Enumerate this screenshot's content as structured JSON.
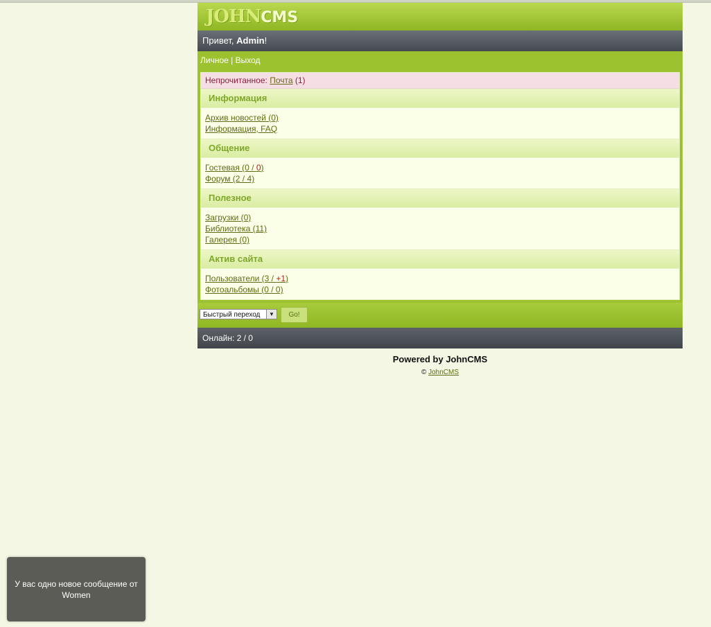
{
  "header": {
    "logo_main": "JOHN",
    "logo_sub": "CMS",
    "greeting_prefix": "Привет, ",
    "greeting_user": "Admin",
    "greeting_suffix": "!"
  },
  "nav": {
    "personal": "Личное",
    "separator": " | ",
    "logout": "Выход"
  },
  "unread": {
    "label": "Непрочитанное: ",
    "mail_link": "Почта",
    "mail_count": " (1)"
  },
  "sections": [
    {
      "title": "Информация",
      "links": [
        "Архив новостей (0)",
        "Информация, FAQ"
      ]
    },
    {
      "title": "Общение",
      "links": [
        "Гостевая (0 / ",
        "Форум (2 / 4)"
      ],
      "guest_red": "0",
      "guest_close": ")"
    },
    {
      "title": "Полезное",
      "links": [
        "Загрузки (0)",
        "Библиотека (11)",
        "Галерея (0)"
      ]
    },
    {
      "title": "Актив сайта",
      "links": [
        "Пользователи (3 / ",
        "Фотоальбомы (0 / 0)"
      ],
      "users_red": "+1",
      "users_close": ")"
    }
  ],
  "quick_jump": {
    "selected": "Быстрый переход",
    "go_label": "Go!"
  },
  "online": {
    "text": "Онлайн: 2 / 0"
  },
  "footer": {
    "powered": "Powered by JohnCMS",
    "copy_symbol": "© ",
    "copy_link": "JohnCMS"
  },
  "toast": {
    "message": "У вас одно новое сообщение от Women"
  }
}
